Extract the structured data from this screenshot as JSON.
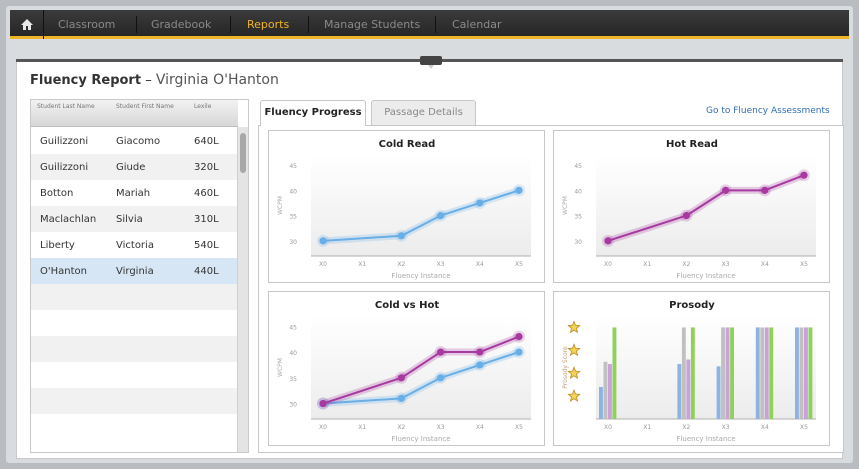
{
  "nav": {
    "home_icon": "home-icon",
    "items": [
      "Classroom",
      "Gradebook",
      "Reports",
      "Manage Students",
      "Calendar"
    ],
    "active": "Reports",
    "accent": "#f0b429"
  },
  "report": {
    "title": "Fluency Report",
    "separator": "–",
    "student_name": "Virginia O'Hanton"
  },
  "students": {
    "headers": [
      "Student Last Name",
      "Student First Name",
      "Lexile"
    ],
    "rows": [
      {
        "last": "Guilizzoni",
        "first": "Giacomo",
        "lexile": "640L"
      },
      {
        "last": "Guilizzoni",
        "first": "Giude",
        "lexile": "320L"
      },
      {
        "last": "Botton",
        "first": "Mariah",
        "lexile": "460L"
      },
      {
        "last": "Maclachlan",
        "first": "Silvia",
        "lexile": "310L"
      },
      {
        "last": "Liberty",
        "first": "Victoria",
        "lexile": "540L"
      },
      {
        "last": "O'Hanton",
        "first": "Virginia",
        "lexile": "440L"
      }
    ],
    "selected_index": 5
  },
  "tabs": [
    "Fluency Progress",
    "Passage Details"
  ],
  "active_tab": "Fluency Progress",
  "assessments_link": "Go to Fluency Assessments",
  "chart_data": [
    {
      "type": "line",
      "title": "Cold Read",
      "xlabel": "Fluency Instance",
      "ylabel": "WCPM",
      "categories": [
        "X0",
        "X1",
        "X2",
        "X3",
        "X4",
        "X5"
      ],
      "yticks": [
        30,
        35,
        40,
        45
      ],
      "ylim": [
        27,
        47
      ],
      "grid": false,
      "series": [
        {
          "color": "#6aaee6",
          "points": [
            [
              0,
              30
            ],
            [
              2,
              31
            ],
            [
              3,
              35
            ],
            [
              4,
              37.5
            ],
            [
              5,
              40
            ]
          ]
        }
      ]
    },
    {
      "type": "line",
      "title": "Hot Read",
      "xlabel": "Fluency Instance",
      "ylabel": "WCPM",
      "categories": [
        "X0",
        "X1",
        "X2",
        "X3",
        "X4",
        "X5"
      ],
      "yticks": [
        30,
        35,
        40,
        45
      ],
      "ylim": [
        27,
        47
      ],
      "grid": false,
      "series": [
        {
          "color": "#a63aa0",
          "points": [
            [
              0,
              30
            ],
            [
              2,
              35
            ],
            [
              3,
              40
            ],
            [
              4,
              40
            ],
            [
              5,
              43
            ]
          ]
        }
      ]
    },
    {
      "type": "line",
      "title": "Cold vs Hot",
      "xlabel": "Fluency Instance",
      "ylabel": "WCPM",
      "categories": [
        "X0",
        "X1",
        "X2",
        "X3",
        "X4",
        "X5"
      ],
      "yticks": [
        30,
        35,
        40,
        45
      ],
      "ylim": [
        27,
        47
      ],
      "grid": false,
      "series": [
        {
          "color": "#6aaee6",
          "points": [
            [
              0,
              30
            ],
            [
              2,
              31
            ],
            [
              3,
              35
            ],
            [
              4,
              37.5
            ],
            [
              5,
              40
            ]
          ]
        },
        {
          "color": "#a63aa0",
          "points": [
            [
              0,
              30
            ],
            [
              2,
              35
            ],
            [
              3,
              40
            ],
            [
              4,
              40
            ],
            [
              5,
              43
            ]
          ]
        }
      ]
    },
    {
      "type": "bar",
      "title": "Prosody",
      "xlabel": "Fluency Instance",
      "ylabel": "Prosody Score",
      "categories": [
        "X0",
        "X1",
        "X2",
        "X3",
        "X4",
        "X5"
      ],
      "ylim": [
        0,
        4.5
      ],
      "star_levels": [
        1,
        2,
        3,
        4
      ],
      "grid": false,
      "series": [
        {
          "color": "#8fb3e0",
          "values": [
            1.4,
            0,
            2.4,
            2.3,
            4,
            4
          ]
        },
        {
          "color": "#c0c0c0",
          "values": [
            2.5,
            0,
            4,
            4,
            4,
            4
          ]
        },
        {
          "color": "#c8a2d8",
          "values": [
            2.4,
            0,
            2.6,
            4,
            4,
            4
          ]
        },
        {
          "color": "#8fd25a",
          "values": [
            4,
            0,
            4,
            4,
            4,
            4
          ]
        }
      ]
    }
  ]
}
